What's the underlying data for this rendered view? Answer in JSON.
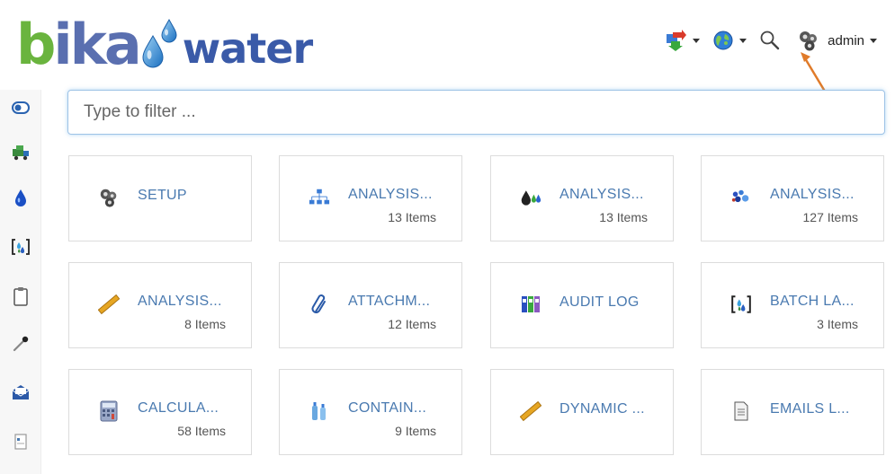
{
  "header": {
    "logo_bika_b": "b",
    "logo_bika_rest": "ika",
    "logo_water": "water",
    "user_label": "admin",
    "icons": [
      "import-export-icon",
      "globe-icon",
      "search-icon",
      "gears-icon"
    ]
  },
  "filter": {
    "placeholder": "Type to filter ..."
  },
  "sidebar": {
    "items": [
      "toggle-icon",
      "truck-icon",
      "water-drop-icon",
      "sample-bracket-icon",
      "clipboard-icon",
      "pipette-icon",
      "mail-icon",
      "document-icon"
    ]
  },
  "tiles": [
    {
      "title": "SETUP",
      "count": ""
    },
    {
      "title": "ANALYSIS...",
      "count": "13 Items"
    },
    {
      "title": "ANALYSIS...",
      "count": "13 Items"
    },
    {
      "title": "ANALYSIS...",
      "count": "127 Items"
    },
    {
      "title": "ANALYSIS...",
      "count": "8 Items"
    },
    {
      "title": "ATTACHM...",
      "count": "12 Items"
    },
    {
      "title": "AUDIT LOG",
      "count": ""
    },
    {
      "title": "BATCH LA...",
      "count": "3 Items"
    },
    {
      "title": "CALCULA...",
      "count": "58 Items"
    },
    {
      "title": "CONTAIN...",
      "count": "9 Items"
    },
    {
      "title": "DYNAMIC ...",
      "count": ""
    },
    {
      "title": "EMAILS L...",
      "count": ""
    }
  ],
  "colors": {
    "accent": "#4a7ab0",
    "logo_green": "#6ab43e",
    "logo_blue": "#3a5aa8",
    "arrow": "#e07b2a"
  }
}
